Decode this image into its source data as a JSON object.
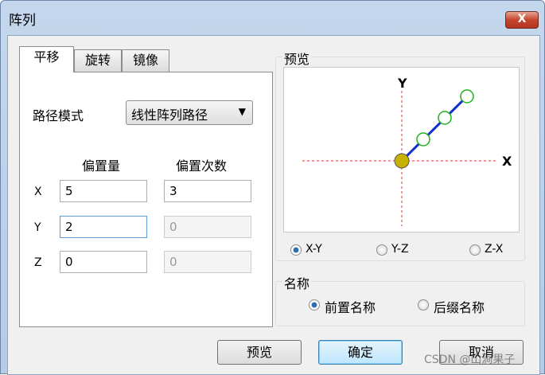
{
  "window": {
    "title": "阵列",
    "close_label": "X"
  },
  "tabs": [
    {
      "label": "平移"
    },
    {
      "label": "旋转"
    },
    {
      "label": "镜像"
    }
  ],
  "path_mode": {
    "label": "路径模式",
    "value": "线性阵列路径",
    "arrow": "▼"
  },
  "columns": {
    "offset": "偏置量",
    "count": "偏置次数"
  },
  "rows": [
    {
      "axis": "X",
      "offset": "5",
      "count": "3"
    },
    {
      "axis": "Y",
      "offset": "2",
      "count": "0"
    },
    {
      "axis": "Z",
      "offset": "0",
      "count": "0"
    }
  ],
  "preview": {
    "title": "预览",
    "axis_x": "X",
    "axis_y": "Y",
    "planes": [
      {
        "label": "X-Y",
        "selected": true
      },
      {
        "label": "Y-Z",
        "selected": false
      },
      {
        "label": "Z-X",
        "selected": false
      }
    ]
  },
  "naming": {
    "title": "名称",
    "options": [
      {
        "label": "前置名称",
        "selected": true
      },
      {
        "label": "后缀名称",
        "selected": false
      }
    ]
  },
  "buttons": {
    "preview": "预览",
    "ok": "确定",
    "cancel": "取消"
  },
  "watermark": "CSDN @山涧果子"
}
